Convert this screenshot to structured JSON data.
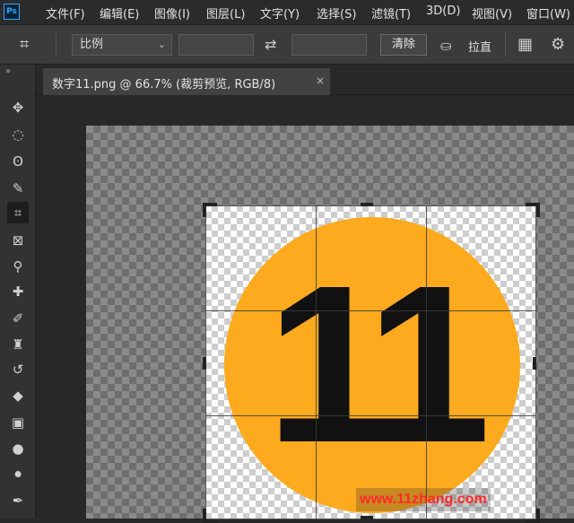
{
  "app": {
    "logo": "Ps"
  },
  "menu": [
    "文件(F)",
    "编辑(E)",
    "图像(I)",
    "图层(L)",
    "文字(Y)",
    "选择(S)",
    "滤镜(T)",
    "3D(D)",
    "视图(V)",
    "窗口(W)"
  ],
  "options": {
    "ratio_label": "比例",
    "width_value": "",
    "height_value": "",
    "clear_label": "清除",
    "straighten_label": "拉直"
  },
  "document": {
    "tab_title": "数字11.png @ 66.7% (裁剪预览, RGB/8)",
    "close_glyph": "×"
  },
  "canvas": {
    "number_text": "11",
    "circle_color": "#fdaa1f"
  },
  "watermark": "www.11zhang.com",
  "colors": {
    "accent": "#31a8ff",
    "workspace": "#282828",
    "panel": "#3b3b3b"
  }
}
